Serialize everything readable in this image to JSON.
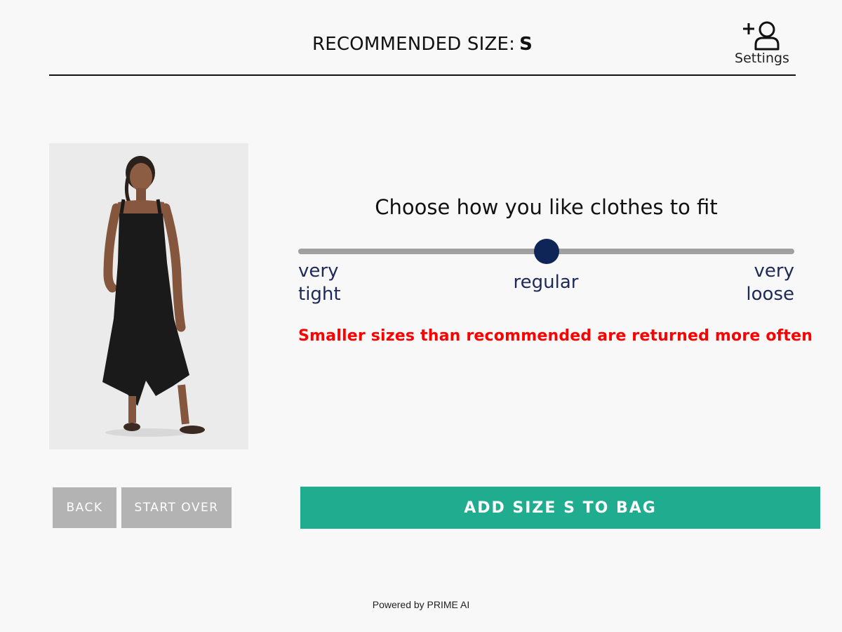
{
  "header": {
    "title_label": "RECOMMENDED SIZE:",
    "recommended_size": "S",
    "settings_label": "Settings",
    "settings_icon": "add-user-icon"
  },
  "product": {
    "image_subject": "woman-in-black-jumpsuit-photo"
  },
  "fit": {
    "title": "Choose how you like clothes to fit",
    "slider_value": 0.5,
    "left_label_line1": "very",
    "left_label_line2": "tight",
    "middle_label": "regular",
    "right_label_line1": "very",
    "right_label_line2": "loose",
    "warning": "Smaller sizes than recommended are returned more often"
  },
  "actions": {
    "back_label": "BACK",
    "start_over_label": "START OVER",
    "add_to_bag_label": "ADD SIZE S TO BAG"
  },
  "footer": {
    "powered_by": "Powered by PRIME AI"
  },
  "colors": {
    "accent": "#20ad8f",
    "slider_thumb": "#0f2557",
    "warning": "#ff0000",
    "secondary_button": "#b3b3b3"
  }
}
